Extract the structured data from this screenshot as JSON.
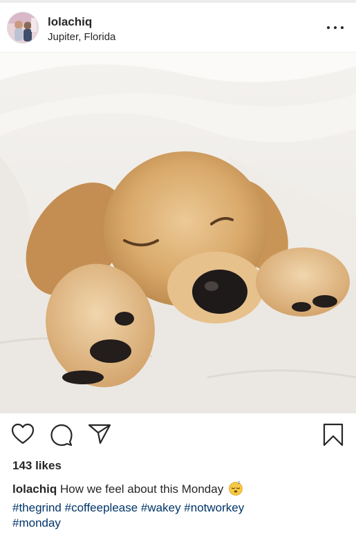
{
  "post": {
    "username": "lolachiq",
    "location": "Jupiter, Florida",
    "likes": "143 likes",
    "caption_text": "How we feel about this Monday",
    "hashtags": [
      "#thegrind",
      "#coffeeplease",
      "#wakey",
      "#notworkey",
      "#monday"
    ]
  },
  "icons": {
    "more": "more-options-icon",
    "like": "heart-icon",
    "comment": "comment-icon",
    "share": "paper-plane-icon",
    "save": "bookmark-icon",
    "emoji": "sleeping-face-emoji"
  },
  "colors": {
    "text": "#262626",
    "hashtag": "#003569",
    "divider": "#efefef"
  }
}
